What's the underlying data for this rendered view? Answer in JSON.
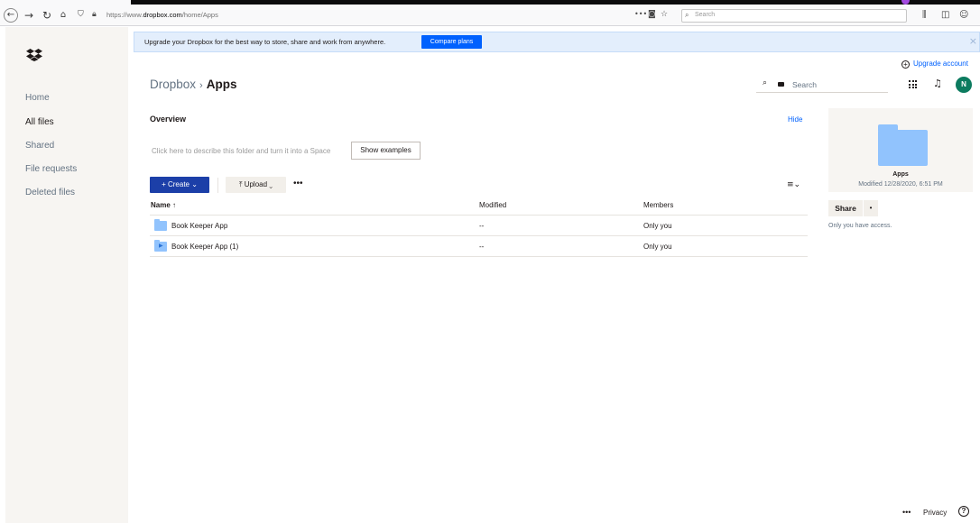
{
  "browser": {
    "url_prefix": "https://www.",
    "url_domain": "dropbox.com",
    "url_path": "/home/Apps",
    "search_placeholder": "Search"
  },
  "sidebar": {
    "items": [
      {
        "label": "Home"
      },
      {
        "label": "All files"
      },
      {
        "label": "Shared"
      },
      {
        "label": "File requests"
      },
      {
        "label": "Deleted files"
      }
    ]
  },
  "banner": {
    "message": "Upgrade your Dropbox for the best way to store, share and work from anywhere.",
    "button_label": "Compare plans"
  },
  "header": {
    "upgrade_label": "Upgrade account",
    "breadcrumb_root": "Dropbox",
    "breadcrumb_current": "Apps",
    "search_placeholder": "Search",
    "avatar_initial": "N"
  },
  "overview": {
    "title": "Overview",
    "hide_label": "Hide",
    "description": "Click here to describe this folder and turn it into a Space",
    "show_examples_label": "Show examples"
  },
  "toolbar": {
    "create_label": "+ Create ⌄",
    "upload_label": "⤒ Upload ⌄",
    "more_label": "•••"
  },
  "table": {
    "headers": {
      "name": "Name ↑",
      "modified": "Modified",
      "members": "Members"
    },
    "rows": [
      {
        "name": "Book Keeper App",
        "modified": "--",
        "members": "Only you"
      },
      {
        "name": "Book Keeper App (1)",
        "modified": "--",
        "members": "Only you"
      }
    ]
  },
  "info_panel": {
    "folder_name": "Apps",
    "modified": "Modified 12/28/2020, 6:51 PM",
    "share_label": "Share",
    "share_more": "•",
    "access_text": "Only you have access."
  },
  "footer": {
    "more_label": "•••",
    "privacy_label": "Privacy",
    "help_label": "?"
  }
}
